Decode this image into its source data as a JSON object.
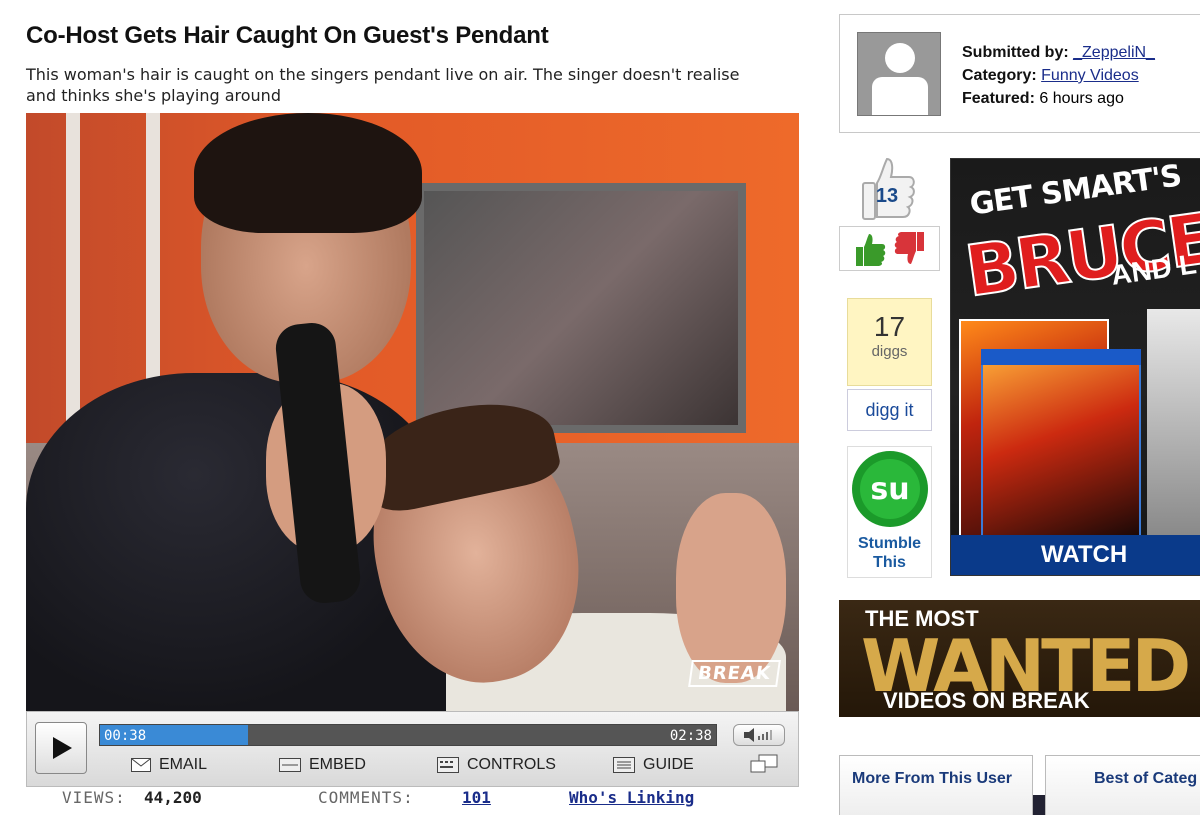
{
  "video": {
    "title": "Co-Host Gets Hair Caught On Guest's Pendant",
    "description": "This woman's hair is caught on the singers pendant live on air. The singer doesn't realise and thinks she's playing around",
    "watermark": "BREAK"
  },
  "player": {
    "current_time": "00:38",
    "total_time": "02:38",
    "progress_fraction": 0.24,
    "buttons": {
      "email": "EMAIL",
      "embed": "EMBED",
      "controls": "CONTROLS",
      "guide": "GUIDE"
    },
    "accent_color": "#3a8ad6"
  },
  "stats": {
    "views_label": "VIEWS:",
    "views_value": "44,200",
    "comments_label": "COMMENTS:",
    "comments_value": "101",
    "whos_linking": "Who's Linking"
  },
  "submission": {
    "submitted_by_label": "Submitted by:",
    "submitted_by_value": "_ZeppeliN_",
    "category_label": "Category:",
    "category_value": "Funny Videos",
    "featured_label": "Featured:",
    "featured_value": "6 hours ago"
  },
  "rating": {
    "thumbs_count": "13"
  },
  "digg": {
    "count": "17",
    "unit": "diggs",
    "button": "digg it"
  },
  "stumble": {
    "line1": "Stumble",
    "line2": "This"
  },
  "ads": {
    "ad1": {
      "line1": "GET SMART'S",
      "line2": "BRUCE",
      "line3": "AND L",
      "footer": "WATCH VIDEOS &"
    },
    "ad2": {
      "line1": "THE MOST",
      "line2": "WANTED",
      "line3": "VIDEOS ON BREAK"
    }
  },
  "tabs": {
    "more_from_user": "More From This User",
    "best_of_category": "Best of Categ"
  }
}
